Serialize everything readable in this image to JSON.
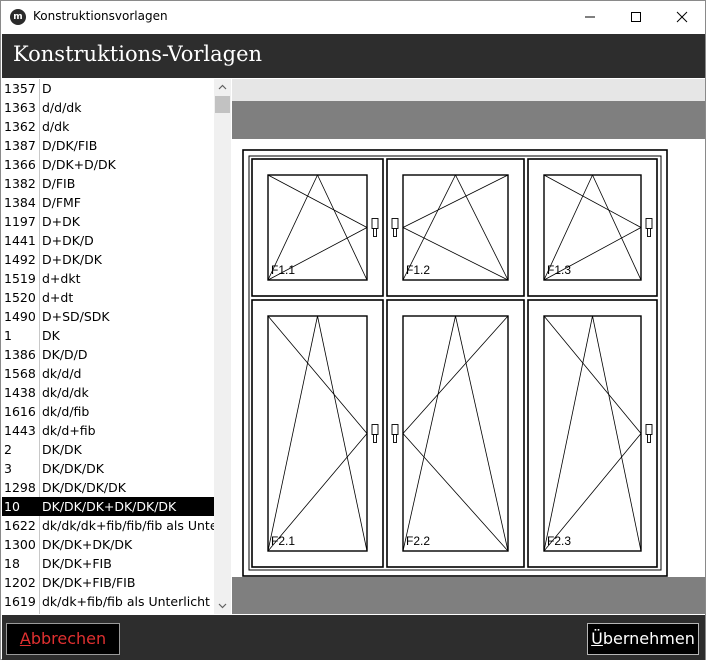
{
  "window": {
    "title": "Konstruktionsvorlagen",
    "app_icon_glyph": "m"
  },
  "header": {
    "title": "Konstruktions-Vorlagen"
  },
  "templates": [
    {
      "id": "1357",
      "name": "D"
    },
    {
      "id": "1363",
      "name": "d/d/dk"
    },
    {
      "id": "1362",
      "name": "d/dk"
    },
    {
      "id": "1387",
      "name": "D/DK/FIB"
    },
    {
      "id": "1366",
      "name": "D/DK+D/DK"
    },
    {
      "id": "1382",
      "name": "D/FIB"
    },
    {
      "id": "1384",
      "name": "D/FMF"
    },
    {
      "id": "1197",
      "name": "D+DK"
    },
    {
      "id": "1441",
      "name": "D+DK/D"
    },
    {
      "id": "1492",
      "name": "D+DK/DK"
    },
    {
      "id": "1519",
      "name": "d+dkt"
    },
    {
      "id": "1520",
      "name": "d+dt"
    },
    {
      "id": "1490",
      "name": "D+SD/SDK"
    },
    {
      "id": "1",
      "name": "DK"
    },
    {
      "id": "1386",
      "name": "DK/D/D"
    },
    {
      "id": "1568",
      "name": "dk/d/d"
    },
    {
      "id": "1438",
      "name": "dk/d/dk"
    },
    {
      "id": "1616",
      "name": "dk/d/fib"
    },
    {
      "id": "1443",
      "name": "dk/d+fib"
    },
    {
      "id": "2",
      "name": "DK/DK"
    },
    {
      "id": "3",
      "name": "DK/DK/DK"
    },
    {
      "id": "1298",
      "name": "DK/DK/DK/DK"
    },
    {
      "id": "10",
      "name": "DK/DK/DK+DK/DK/DK",
      "selected": true
    },
    {
      "id": "1622",
      "name": "dk/dk/dk+fib/fib/fib als Unterlicht"
    },
    {
      "id": "1300",
      "name": "DK/DK+DK/DK"
    },
    {
      "id": "18",
      "name": "DK/DK+FIB"
    },
    {
      "id": "1202",
      "name": "DK/DK+FIB/FIB"
    },
    {
      "id": "1619",
      "name": "dk/dk+fib/fib als Unterlicht"
    }
  ],
  "preview": {
    "sash_labels": [
      "F1.1",
      "F1.2",
      "F1.3",
      "F2.1",
      "F2.2",
      "F2.3"
    ]
  },
  "footer": {
    "cancel_label": "Abbrechen",
    "apply_label": "Übernehmen"
  },
  "colors": {
    "header_bg": "#2d2d2d",
    "selection_bg": "#000000",
    "cancel_text": "#e03030",
    "preview_bar": "#7f7f7f"
  },
  "icons": {
    "minimize": "minimize-icon",
    "maximize": "maximize-icon",
    "close": "close-icon",
    "scroll_up": "chevron-up-icon",
    "scroll_down": "chevron-down-icon"
  }
}
